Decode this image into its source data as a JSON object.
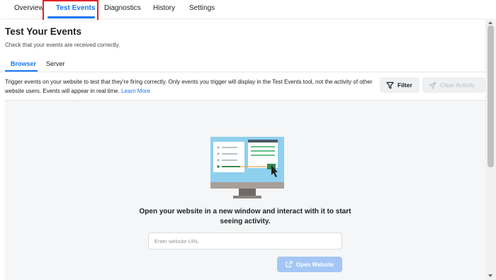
{
  "top_tabs": [
    {
      "label": "Overview"
    },
    {
      "label": "Test Events"
    },
    {
      "label": "Diagnostics"
    },
    {
      "label": "History"
    },
    {
      "label": "Settings"
    }
  ],
  "active_top_tab": "Test Events",
  "page": {
    "title": "Test Your Events",
    "subtitle": "Check that your events are received correctly."
  },
  "sub_tabs": [
    {
      "label": "Browser"
    },
    {
      "label": "Server"
    }
  ],
  "active_sub_tab": "Browser",
  "description": {
    "text": "Trigger events on your website to test that they're firing correctly. Only events you trigger will display in the Test Events tool, not the activity of other website users. Events will appear in real time.",
    "link": "Learn More"
  },
  "toolbar": {
    "filter_label": "Filter",
    "clear_label": "Clear Activity"
  },
  "empty_state": {
    "prompt": "Open your website in a new window and interact with it to start seeing activity.",
    "url_placeholder": "Enter website URL",
    "open_button_label": "Open Website"
  },
  "icons": {
    "filter": "filter-icon",
    "clear": "send-icon",
    "open": "external-link-icon",
    "illustration": "monitor-illustration"
  },
  "colors": {
    "accent": "#1877f2",
    "highlight_box": "#e0242a",
    "disabled_button": "#a4c6f5"
  }
}
